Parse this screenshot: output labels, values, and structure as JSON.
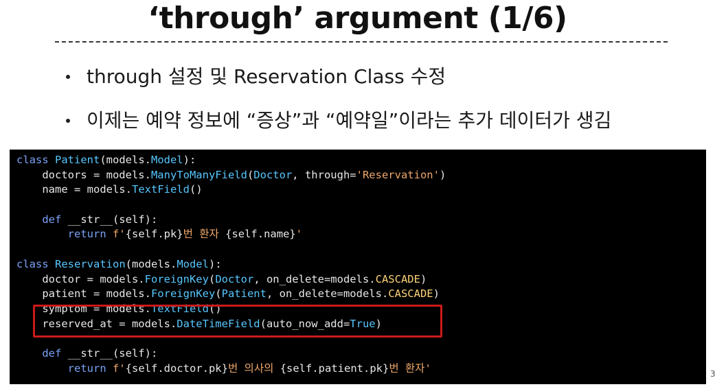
{
  "slide": {
    "title": "‘through’ argument (1/6)",
    "page_number": "3"
  },
  "bullets": [
    "through 설정 및 Reservation Class 수정",
    "이제는 예약 정보에 “증상”과 “예약일”이라는 추가 데이터가 생김"
  ],
  "colors": {
    "keyword": "#7aa2f7",
    "builtin": "#57c7ff",
    "string": "#f0a86a",
    "constant": "#ffd479",
    "text": "#e8e8e8",
    "highlight_border": "#cc1a1a"
  },
  "code": {
    "lines": [
      [
        {
          "t": "class ",
          "c": "keyword"
        },
        {
          "t": "Patient",
          "c": "builtin"
        },
        {
          "t": "(models.",
          "c": "text"
        },
        {
          "t": "Model",
          "c": "builtin"
        },
        {
          "t": "):",
          "c": "text"
        }
      ],
      [
        {
          "t": "    doctors = models.",
          "c": "text"
        },
        {
          "t": "ManyToManyField",
          "c": "builtin"
        },
        {
          "t": "(",
          "c": "text"
        },
        {
          "t": "Doctor",
          "c": "builtin"
        },
        {
          "t": ", through=",
          "c": "text"
        },
        {
          "t": "'Reservation'",
          "c": "string"
        },
        {
          "t": ")",
          "c": "text"
        }
      ],
      [
        {
          "t": "    name = models.",
          "c": "text"
        },
        {
          "t": "TextField",
          "c": "builtin"
        },
        {
          "t": "()",
          "c": "text"
        }
      ],
      [],
      [
        {
          "t": "    ",
          "c": "text"
        },
        {
          "t": "def ",
          "c": "keyword"
        },
        {
          "t": "__str__(self):",
          "c": "text"
        }
      ],
      [
        {
          "t": "        ",
          "c": "text"
        },
        {
          "t": "return ",
          "c": "keyword"
        },
        {
          "t": "f'",
          "c": "string"
        },
        {
          "t": "{self.pk}",
          "c": "text"
        },
        {
          "t": "번 환자 ",
          "c": "string"
        },
        {
          "t": "{self.name}",
          "c": "text"
        },
        {
          "t": "'",
          "c": "string"
        }
      ],
      [],
      [
        {
          "t": "class ",
          "c": "keyword"
        },
        {
          "t": "Reservation",
          "c": "builtin"
        },
        {
          "t": "(models.",
          "c": "text"
        },
        {
          "t": "Model",
          "c": "builtin"
        },
        {
          "t": "):",
          "c": "text"
        }
      ],
      [
        {
          "t": "    doctor = models.",
          "c": "text"
        },
        {
          "t": "ForeignKey",
          "c": "builtin"
        },
        {
          "t": "(",
          "c": "text"
        },
        {
          "t": "Doctor",
          "c": "builtin"
        },
        {
          "t": ", on_delete=models.",
          "c": "text"
        },
        {
          "t": "CASCADE",
          "c": "constant"
        },
        {
          "t": ")",
          "c": "text"
        }
      ],
      [
        {
          "t": "    patient = models.",
          "c": "text"
        },
        {
          "t": "ForeignKey",
          "c": "builtin"
        },
        {
          "t": "(",
          "c": "text"
        },
        {
          "t": "Patient",
          "c": "builtin"
        },
        {
          "t": ", on_delete=models.",
          "c": "text"
        },
        {
          "t": "CASCADE",
          "c": "constant"
        },
        {
          "t": ")",
          "c": "text"
        }
      ],
      [
        {
          "t": "    symptom = models.",
          "c": "text"
        },
        {
          "t": "TextField",
          "c": "builtin"
        },
        {
          "t": "()",
          "c": "text"
        }
      ],
      [
        {
          "t": "    reserved_at = models.",
          "c": "text"
        },
        {
          "t": "DateTimeField",
          "c": "builtin"
        },
        {
          "t": "(auto_now_add=",
          "c": "text"
        },
        {
          "t": "True",
          "c": "builtin"
        },
        {
          "t": ")",
          "c": "text"
        }
      ],
      [],
      [
        {
          "t": "    ",
          "c": "text"
        },
        {
          "t": "def ",
          "c": "keyword"
        },
        {
          "t": "__str__(self):",
          "c": "text"
        }
      ],
      [
        {
          "t": "        ",
          "c": "text"
        },
        {
          "t": "return ",
          "c": "keyword"
        },
        {
          "t": "f'",
          "c": "string"
        },
        {
          "t": "{self.doctor.pk}",
          "c": "text"
        },
        {
          "t": "번 의사의 ",
          "c": "string"
        },
        {
          "t": "{self.patient.pk}",
          "c": "text"
        },
        {
          "t": "번 환자'",
          "c": "string"
        }
      ]
    ]
  }
}
